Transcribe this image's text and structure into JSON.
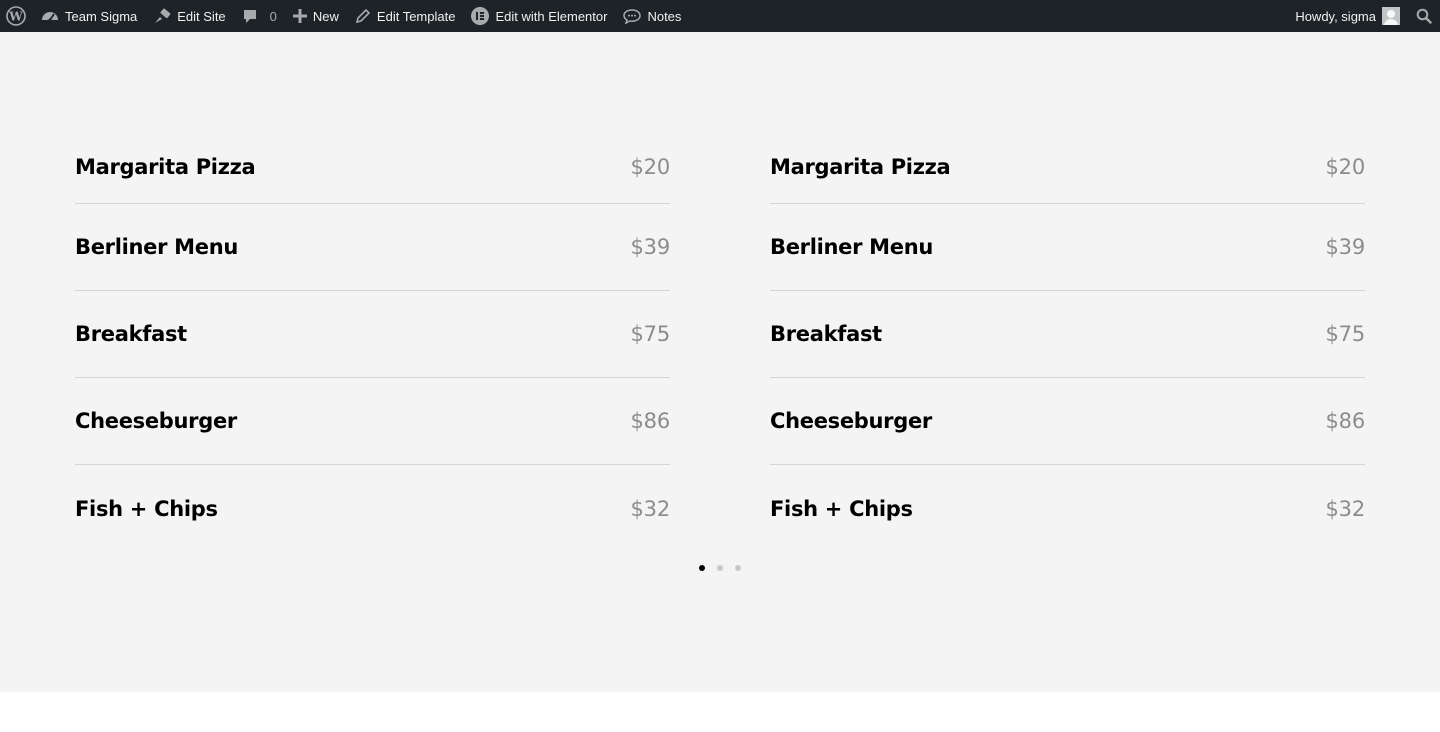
{
  "adminbar": {
    "site_name": "Team Sigma",
    "edit_site": "Edit Site",
    "comments_count": "0",
    "new_label": "New",
    "edit_template": "Edit Template",
    "edit_elementor": "Edit with Elementor",
    "notes": "Notes",
    "howdy": "Howdy, sigma",
    "icons": [
      "wordpress-icon",
      "dashboard-icon",
      "brush-icon",
      "comment-icon",
      "plus-icon",
      "pencil-icon",
      "elementor-icon",
      "notes-icon",
      "avatar",
      "search-icon"
    ],
    "bg_color": "#1d2327"
  },
  "menu": {
    "left": [
      {
        "name": "Margarita Pizza",
        "price": "$20"
      },
      {
        "name": "Berliner Menu",
        "price": "$39"
      },
      {
        "name": "Breakfast",
        "price": "$75"
      },
      {
        "name": "Cheeseburger",
        "price": "$86"
      },
      {
        "name": "Fish + Chips",
        "price": "$32"
      }
    ],
    "right": [
      {
        "name": "Margarita Pizza",
        "price": "$20"
      },
      {
        "name": "Berliner Menu",
        "price": "$39"
      },
      {
        "name": "Breakfast",
        "price": "$75"
      },
      {
        "name": "Cheeseburger",
        "price": "$86"
      },
      {
        "name": "Fish + Chips",
        "price": "$32"
      }
    ]
  },
  "carousel": {
    "pages": 3,
    "active": 1
  },
  "colors": {
    "section_bg": "#f4f4f4",
    "price": "#8c8c8c",
    "divider": "#d4d4d4"
  }
}
